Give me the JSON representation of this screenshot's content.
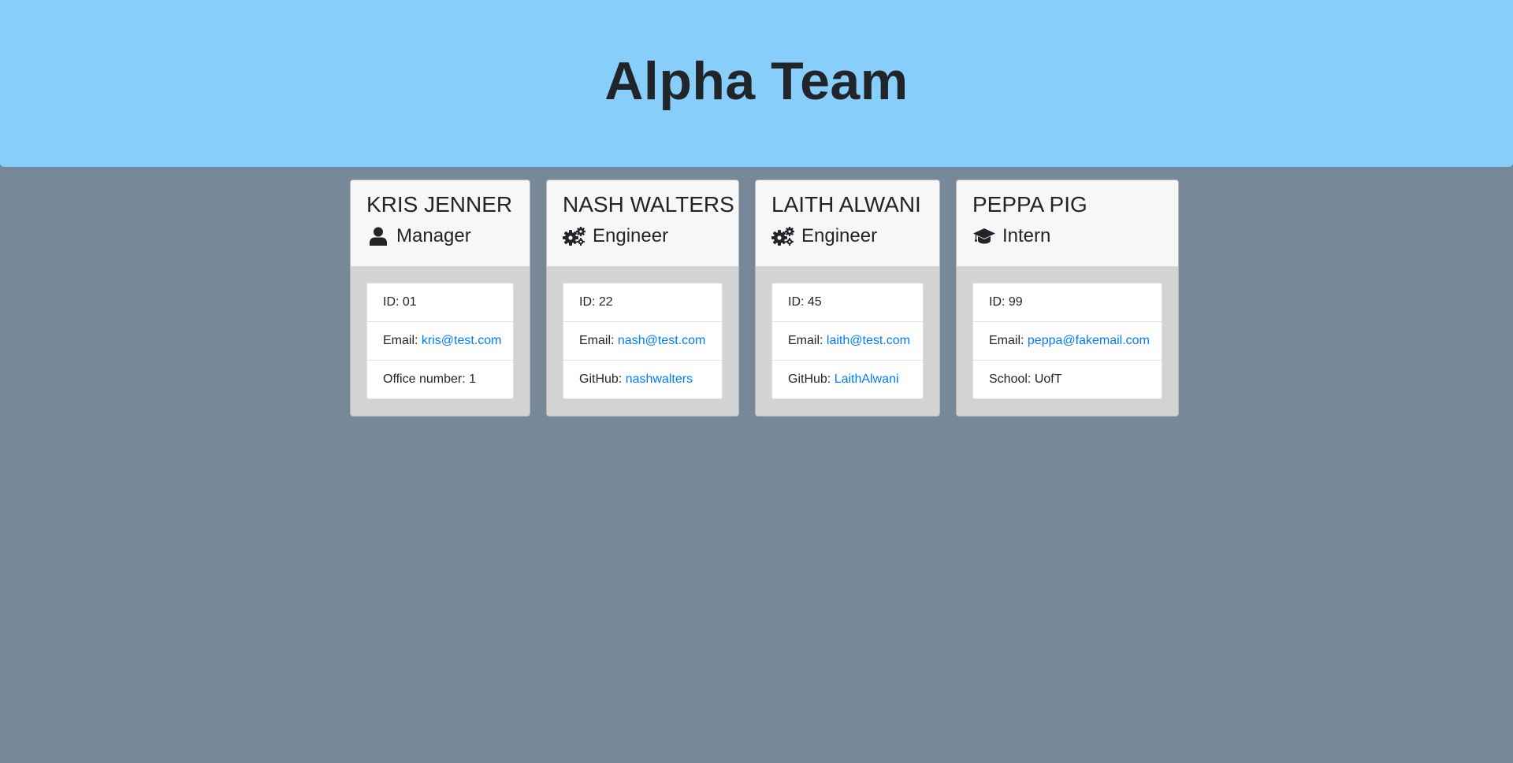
{
  "header": {
    "title": "Alpha Team",
    "background": "#87cefa"
  },
  "page": {
    "background": "#778899",
    "link_color": "#007bff"
  },
  "cards": [
    {
      "name": "KRIS JENNER",
      "role": "Manager",
      "icon": "user-icon",
      "id_label": "ID:",
      "id": "01",
      "email_label": "Email:",
      "email": "kris@test.com",
      "extra_label": "Office number:",
      "extra_value": "1"
    },
    {
      "name": "NASH WALTERS",
      "role": "Engineer",
      "icon": "cogs-icon",
      "id_label": "ID:",
      "id": "22",
      "email_label": "Email:",
      "email": "nash@test.com",
      "extra_label": "GitHub:",
      "extra_value": "nashwalters"
    },
    {
      "name": "LAITH ALWANI",
      "role": "Engineer",
      "icon": "cogs-icon",
      "id_label": "ID:",
      "id": "45",
      "email_label": "Email:",
      "email": "laith@test.com",
      "extra_label": "GitHub:",
      "extra_value": "LaithAlwani"
    },
    {
      "name": "PEPPA PIG",
      "role": "Intern",
      "icon": "graduation-cap-icon",
      "id_label": "ID:",
      "id": "99",
      "email_label": "Email:",
      "email": "peppa@fakemail.com",
      "extra_label": "School:",
      "extra_value": "UofT"
    }
  ]
}
